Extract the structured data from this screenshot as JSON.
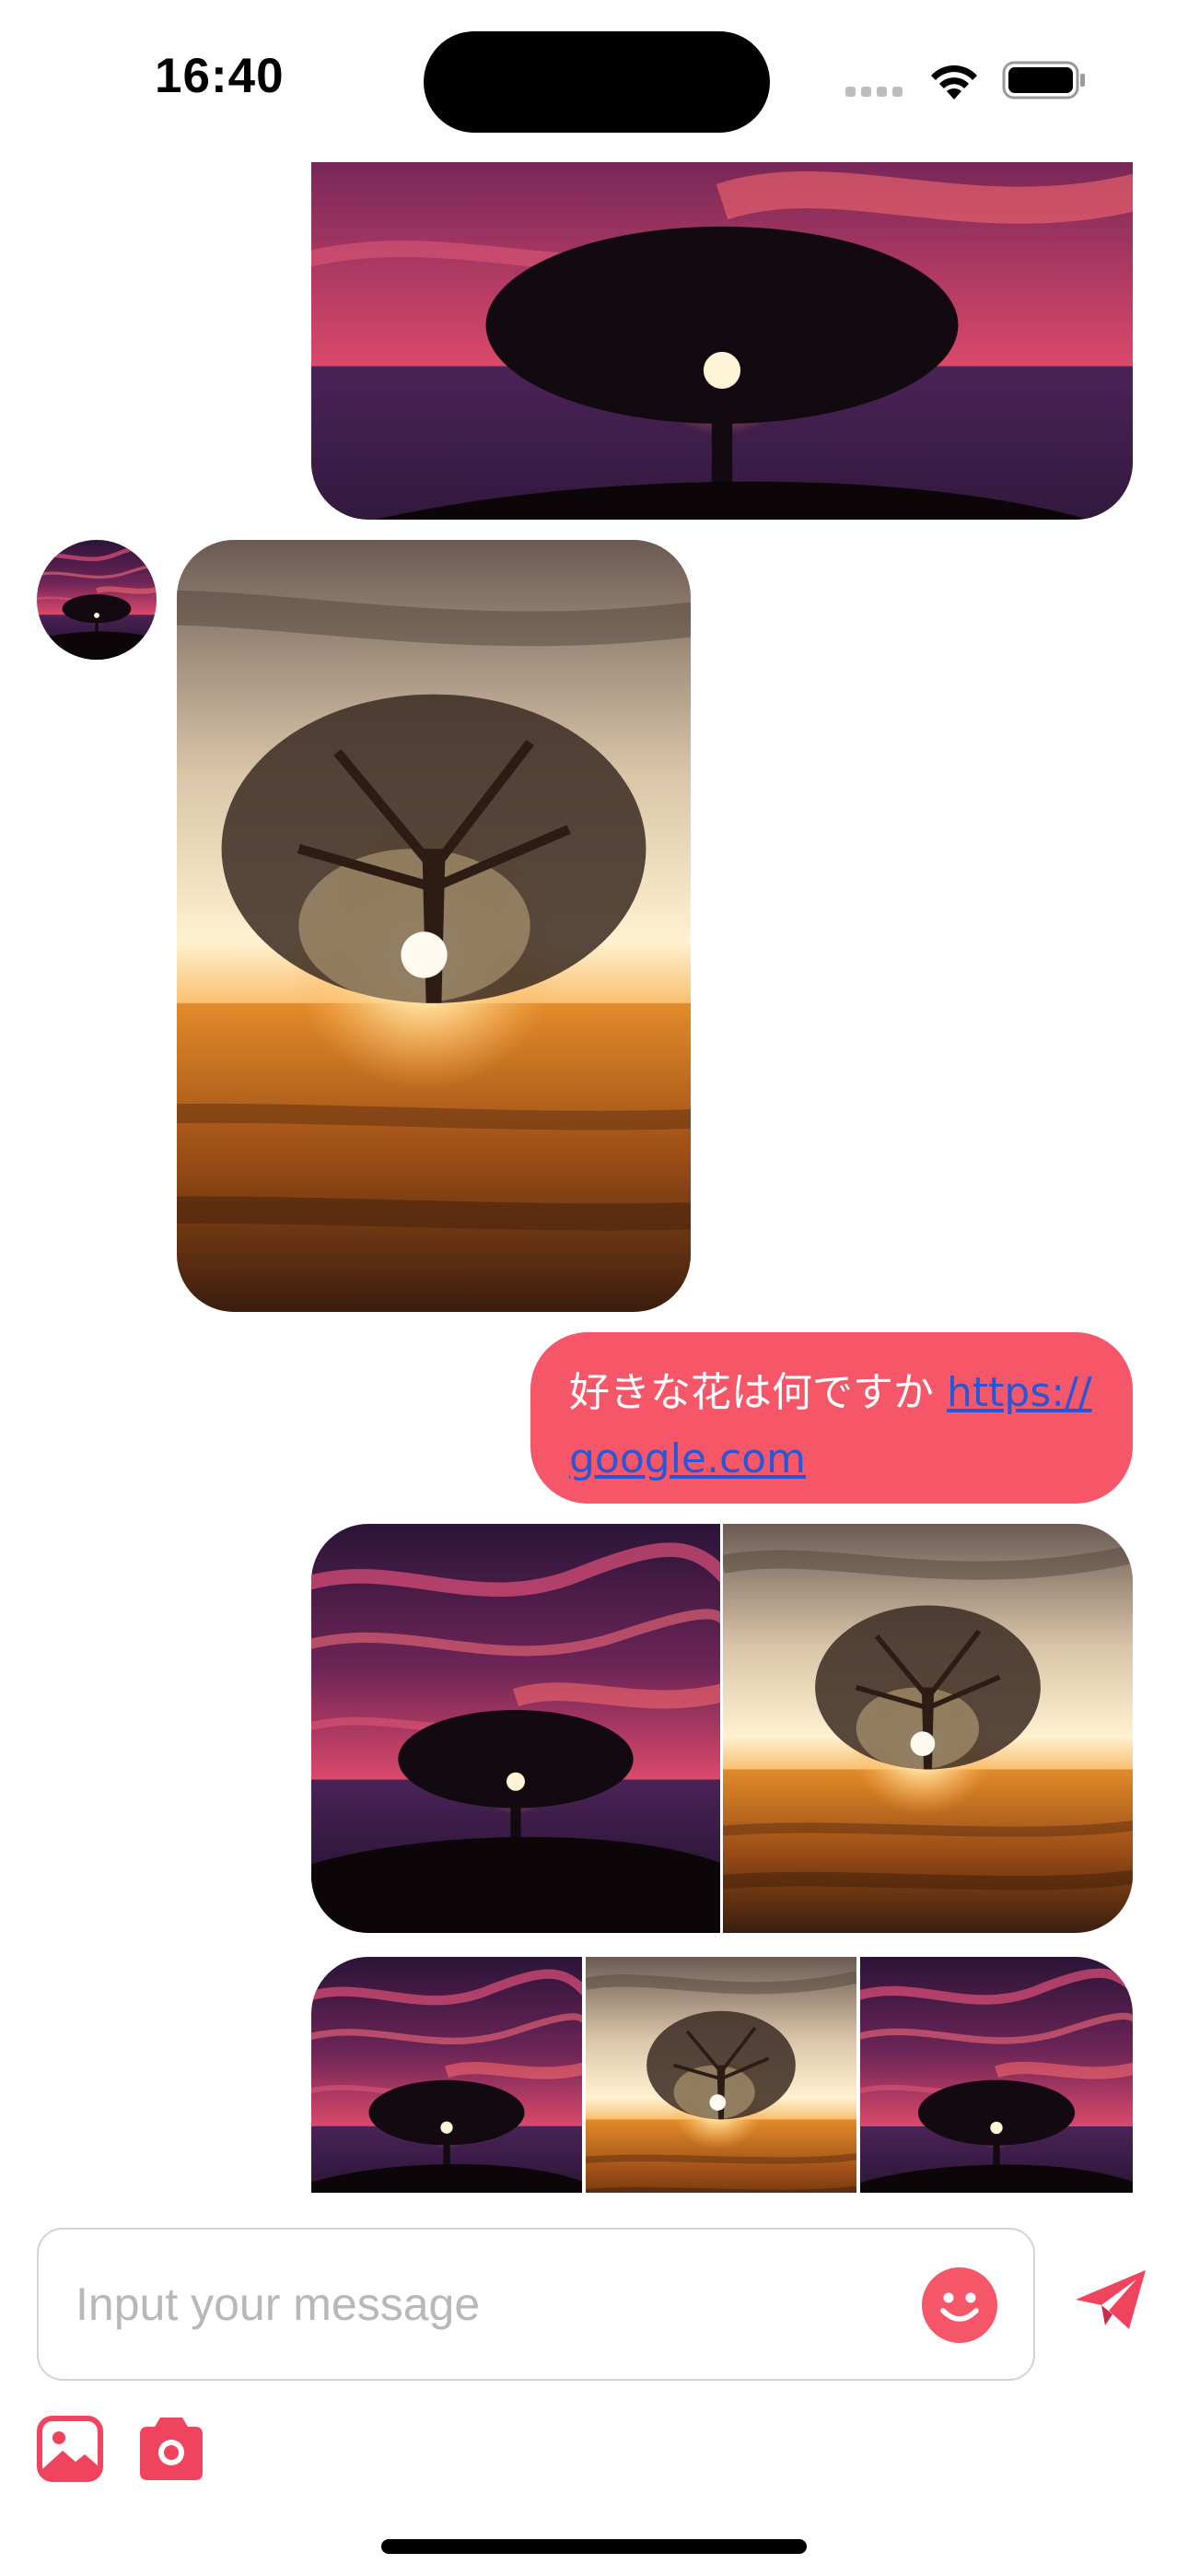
{
  "status_bar": {
    "time": "16:40"
  },
  "chat": {
    "text_message": {
      "text": "好きな花は何ですか ",
      "link": "https://google.com",
      "link_display_part1": "https://",
      "link_display_part2": "google.com"
    }
  },
  "composer": {
    "placeholder": "Input your message",
    "value": ""
  },
  "icons": {
    "emoji": "smile-icon",
    "send": "paper-plane-icon",
    "gallery": "image-icon",
    "camera": "camera-icon"
  },
  "colors": {
    "accent": "#f55668",
    "icon_pink": "#f0435e",
    "link": "#2856d6",
    "placeholder": "#b8b8b8"
  }
}
